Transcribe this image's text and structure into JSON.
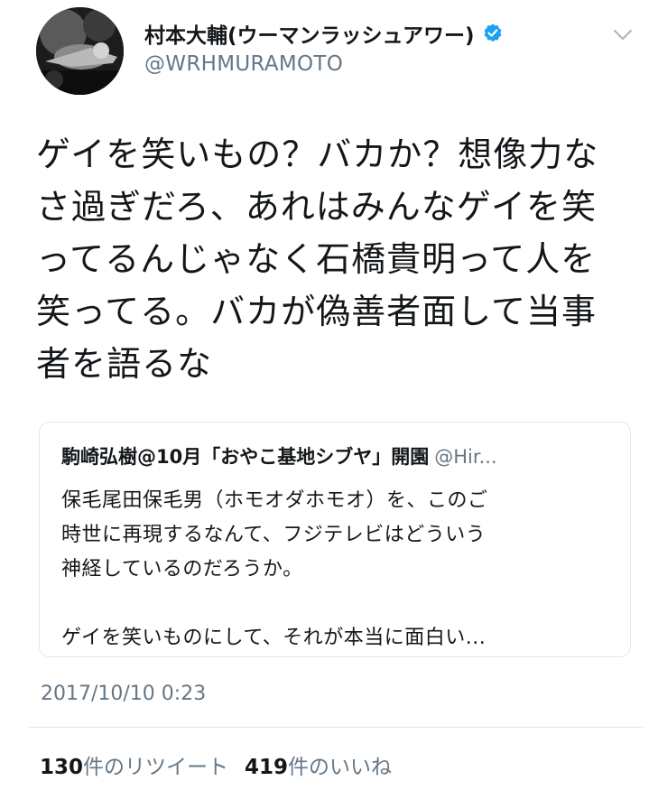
{
  "tweet": {
    "author": {
      "display_name": "村本大輔(ウーマンラッシュアワー)",
      "handle": "@WRHMURAMOTO",
      "verified": true
    },
    "text_lines": [
      "ゲイを笑いもの？バカか？想像力な",
      "さ過ぎだろ、あれはみんなゲイを笑",
      "ってるんじゃなく石橋貴明って人を",
      "笑ってる。バカが偽善者面して当事",
      "者を語るな"
    ],
    "quoted": {
      "author_name": "駒崎弘樹@10月「おやこ基地シブヤ」開園",
      "author_handle": "@Hir...",
      "text_lines": [
        "保毛尾田保毛男（ホモオダホモオ）を、このご",
        "時世に再現するなんて、フジテレビはどういう",
        "神経しているのだろうか。",
        "",
        "ゲイを笑いものにして、それが本当に面白い..."
      ]
    },
    "timestamp": "2017/10/10 0:23",
    "stats": {
      "retweets_count": "130",
      "retweets_label": "件のリツイート",
      "likes_count": "419",
      "likes_label": "件のいいね"
    }
  },
  "icons": {
    "verified": "verified-badge-icon",
    "menu": "chevron-down-icon"
  },
  "colors": {
    "text": "#14171a",
    "secondary": "#657786",
    "verified": "#1da1f2",
    "border": "#e1e8ed"
  }
}
